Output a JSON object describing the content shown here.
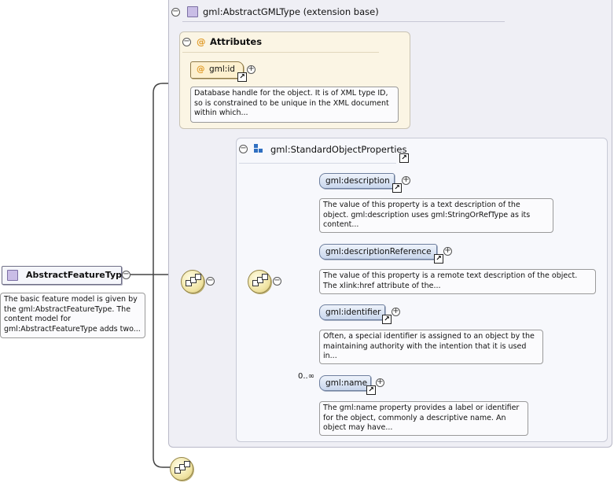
{
  "extension": {
    "label": "gml:AbstractGMLType (extension base)"
  },
  "attributes": {
    "label": "Attributes",
    "item": {
      "name": "gml:id",
      "doc": [
        "Database handle for the object. It is of XML type ID,",
        "so is constrained to be unique in the XML document",
        "within which..."
      ]
    }
  },
  "group": {
    "label": "gml:StandardObjectProperties"
  },
  "elements": [
    {
      "name": "gml:description",
      "doc": [
        "The value of this property is a text description of the",
        "object. gml:description uses gml:StringOrRefType as its",
        "content..."
      ]
    },
    {
      "name": "gml:descriptionReference",
      "doc": [
        "The value of this property is a remote text description of the object.",
        "The xlink:href attribute of the..."
      ]
    },
    {
      "name": "gml:identifier",
      "doc": [
        "Often, a special identifier is assigned to an object by the",
        "maintaining authority with the intention that it is used",
        "in..."
      ]
    },
    {
      "name": "gml:name",
      "occurrence": "0..∞",
      "doc": [
        "The gml:name property provides a label or identifier",
        "for the object, commonly a descriptive name. An",
        "object may have..."
      ]
    }
  ],
  "root": {
    "name": "AbstractFeatureType",
    "doc": [
      "The basic feature model is given by",
      "the gml:AbstractFeatureType. The",
      "content model for",
      "gml:AbstractFeatureType adds two..."
    ]
  },
  "symbols": {
    "collapse": "−",
    "expand": "+",
    "attr_marker": "@",
    "link": "↗"
  },
  "colors": {
    "type_icon": "#c9bde6",
    "attr_bg": "#fbf5e4",
    "element_fill": "#c8d6ec",
    "compositor_fill": "#f1e5a6"
  }
}
